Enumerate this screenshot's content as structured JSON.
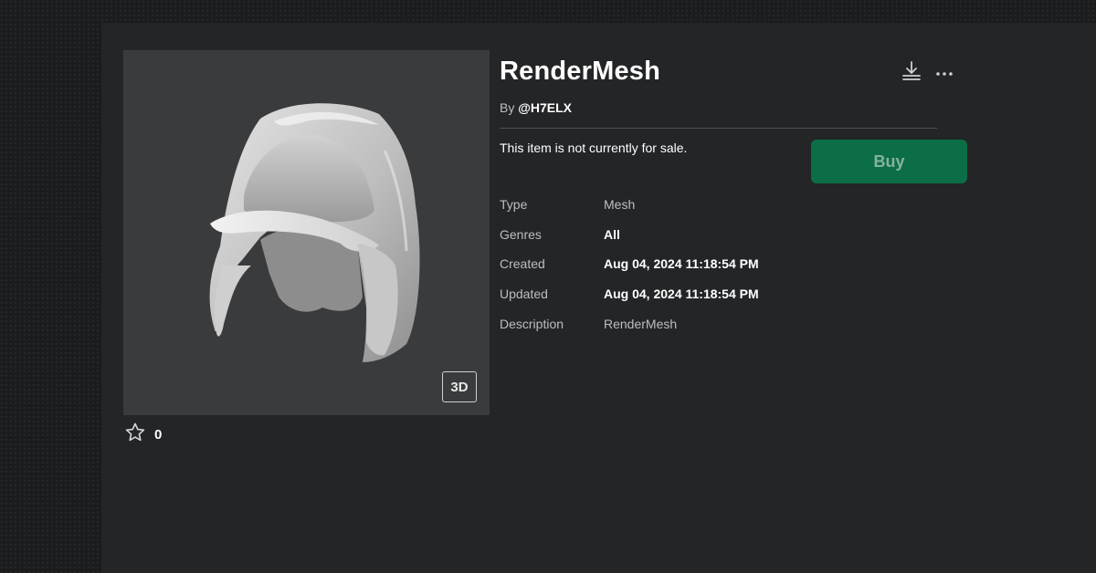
{
  "item": {
    "title": "RenderMesh",
    "by_prefix": "By",
    "creator": "@H7ELX",
    "sale_status": "This item is not currently for sale.",
    "buy_label": "Buy",
    "view_3d_label": "3D",
    "favorites": "0"
  },
  "details": [
    {
      "label": "Type",
      "value": "Mesh"
    },
    {
      "label": "Genres",
      "value": "All"
    },
    {
      "label": "Created",
      "value": "Aug 04, 2024 11:18:54 PM"
    },
    {
      "label": "Updated",
      "value": "Aug 04, 2024 11:18:54 PM"
    },
    {
      "label": "Description",
      "value": "RenderMesh"
    }
  ],
  "icons": {
    "download": "download-icon",
    "more": "more-options-icon",
    "favorite": "star-outline-icon"
  },
  "colors": {
    "buy_button": "#0b6e46",
    "panel": "#232527",
    "thumbnail_bg": "#393b3d"
  }
}
